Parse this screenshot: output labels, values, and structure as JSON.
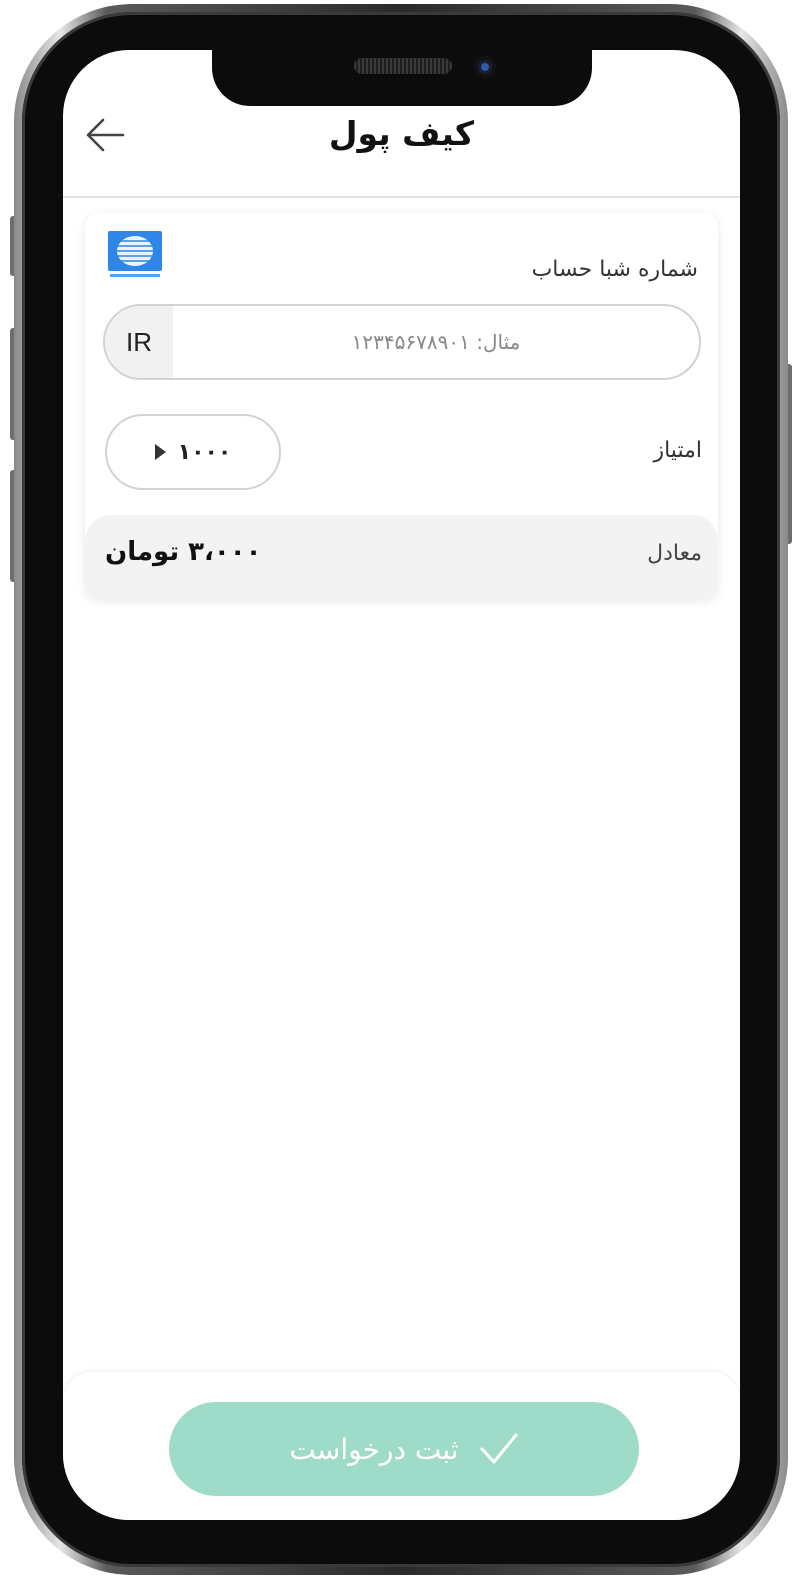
{
  "header": {
    "title": "کیف پول",
    "back_icon": "arrow-left-icon"
  },
  "sheba": {
    "label": "شماره شبا حساب",
    "prefix": "IR",
    "placeholder": "مثال: ۱۲۳۴۵۶۷۸۹۰۱",
    "value": "",
    "bank_logo": "bank-logo-icon"
  },
  "points": {
    "label": "امتیاز",
    "selected_value": "۱۰۰۰",
    "dropdown_icon": "caret-right-icon"
  },
  "equivalent": {
    "label": "معادل",
    "value": "۳،۰۰۰ تومان"
  },
  "submit": {
    "label": "ثبت درخواست",
    "icon": "check-icon",
    "color": "#9edbc8"
  },
  "colors": {
    "accent": "#9edbc8",
    "bank_blue": "#2e86e6"
  }
}
